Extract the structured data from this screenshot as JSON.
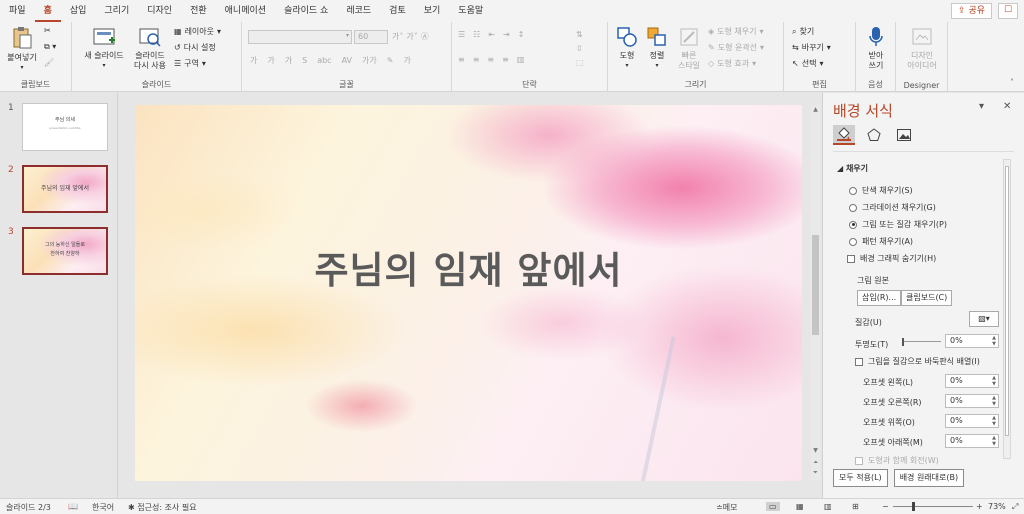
{
  "menu": {
    "tabs": [
      "파일",
      "홈",
      "삽입",
      "그리기",
      "디자인",
      "전환",
      "애니메이션",
      "슬라이드 쇼",
      "레코드",
      "검토",
      "보기",
      "도움말"
    ],
    "active": "홈",
    "share_label": "공유"
  },
  "ribbon": {
    "clipboard": {
      "label": "클립보드",
      "paste": "붙여넣기"
    },
    "slides": {
      "label": "슬라이드",
      "new_slide": "새 슬라이드",
      "reuse_slide_1": "슬라이드",
      "reuse_slide_2": "다시 사용",
      "layout": "레이아웃",
      "reset": "다시 설정",
      "section": "구역"
    },
    "font": {
      "label": "글꼴",
      "size": "60"
    },
    "paragraph": {
      "label": "단락"
    },
    "drawing": {
      "label": "그리기",
      "shape": "도형",
      "arrange": "정렬",
      "quick_style_1": "빠른",
      "quick_style_2": "스타일",
      "fill": "도형 채우기",
      "outline": "도형 윤곽선",
      "effects": "도형 효과"
    },
    "editing": {
      "label": "편집",
      "find": "찾기",
      "replace": "바꾸기",
      "select": "선택"
    },
    "voice": {
      "label": "음성",
      "dictate_1": "받아",
      "dictate_2": "쓰기"
    },
    "designer": {
      "label": "Designer",
      "ideas_1": "디자인",
      "ideas_2": "아이디어"
    }
  },
  "slides": [
    {
      "num": "1",
      "title": "주님 의세",
      "sub": "presentation subtitle"
    },
    {
      "num": "2",
      "title": "주님의 임재 앞에서"
    },
    {
      "num": "3",
      "title": "그의 능하신 일들로\n찬하여 찬양하"
    }
  ],
  "current_slide": {
    "title": "주님의 임재 앞에서"
  },
  "format_pane": {
    "title": "배경 서식",
    "section": "채우기",
    "options": [
      {
        "label": "단색 채우기(S)",
        "selected": false
      },
      {
        "label": "그라데이션 채우기(G)",
        "selected": false
      },
      {
        "label": "그림 또는 질감 채우기(P)",
        "selected": true
      },
      {
        "label": "패턴 채우기(A)",
        "selected": false
      }
    ],
    "hide_graphics": "배경 그래픽 숨기기(H)",
    "picture_source": "그림 원본",
    "insert": "삽입(R)...",
    "clipboard": "클립보드(C)",
    "texture": "질감(U)",
    "transparency": "투명도(T)",
    "transparency_value": "0%",
    "tile": "그림을 질감으로 바둑판식 배열(I)",
    "offset_left": "오프셋 왼쪽(L)",
    "offset_right": "오프셋 오른쪽(R)",
    "offset_top": "오프셋 위쪽(O)",
    "offset_bottom": "오프셋 아래쪽(M)",
    "offset_left_value": "0%",
    "offset_right_value": "0%",
    "offset_top_value": "0%",
    "offset_bottom_value": "0%",
    "rotate_with_shape": "도형과 함께 회전(W)",
    "apply_all": "모두 적용(L)",
    "reset_bg": "배경 원래대로(B)"
  },
  "status": {
    "slide": "슬라이드 2/3",
    "language": "한국어",
    "accessibility": "접근성: 조사 필요",
    "notes": "메모",
    "zoom": "73%"
  },
  "colors": {
    "accent": "#b7472a",
    "title_text": "#5a5a5a"
  }
}
